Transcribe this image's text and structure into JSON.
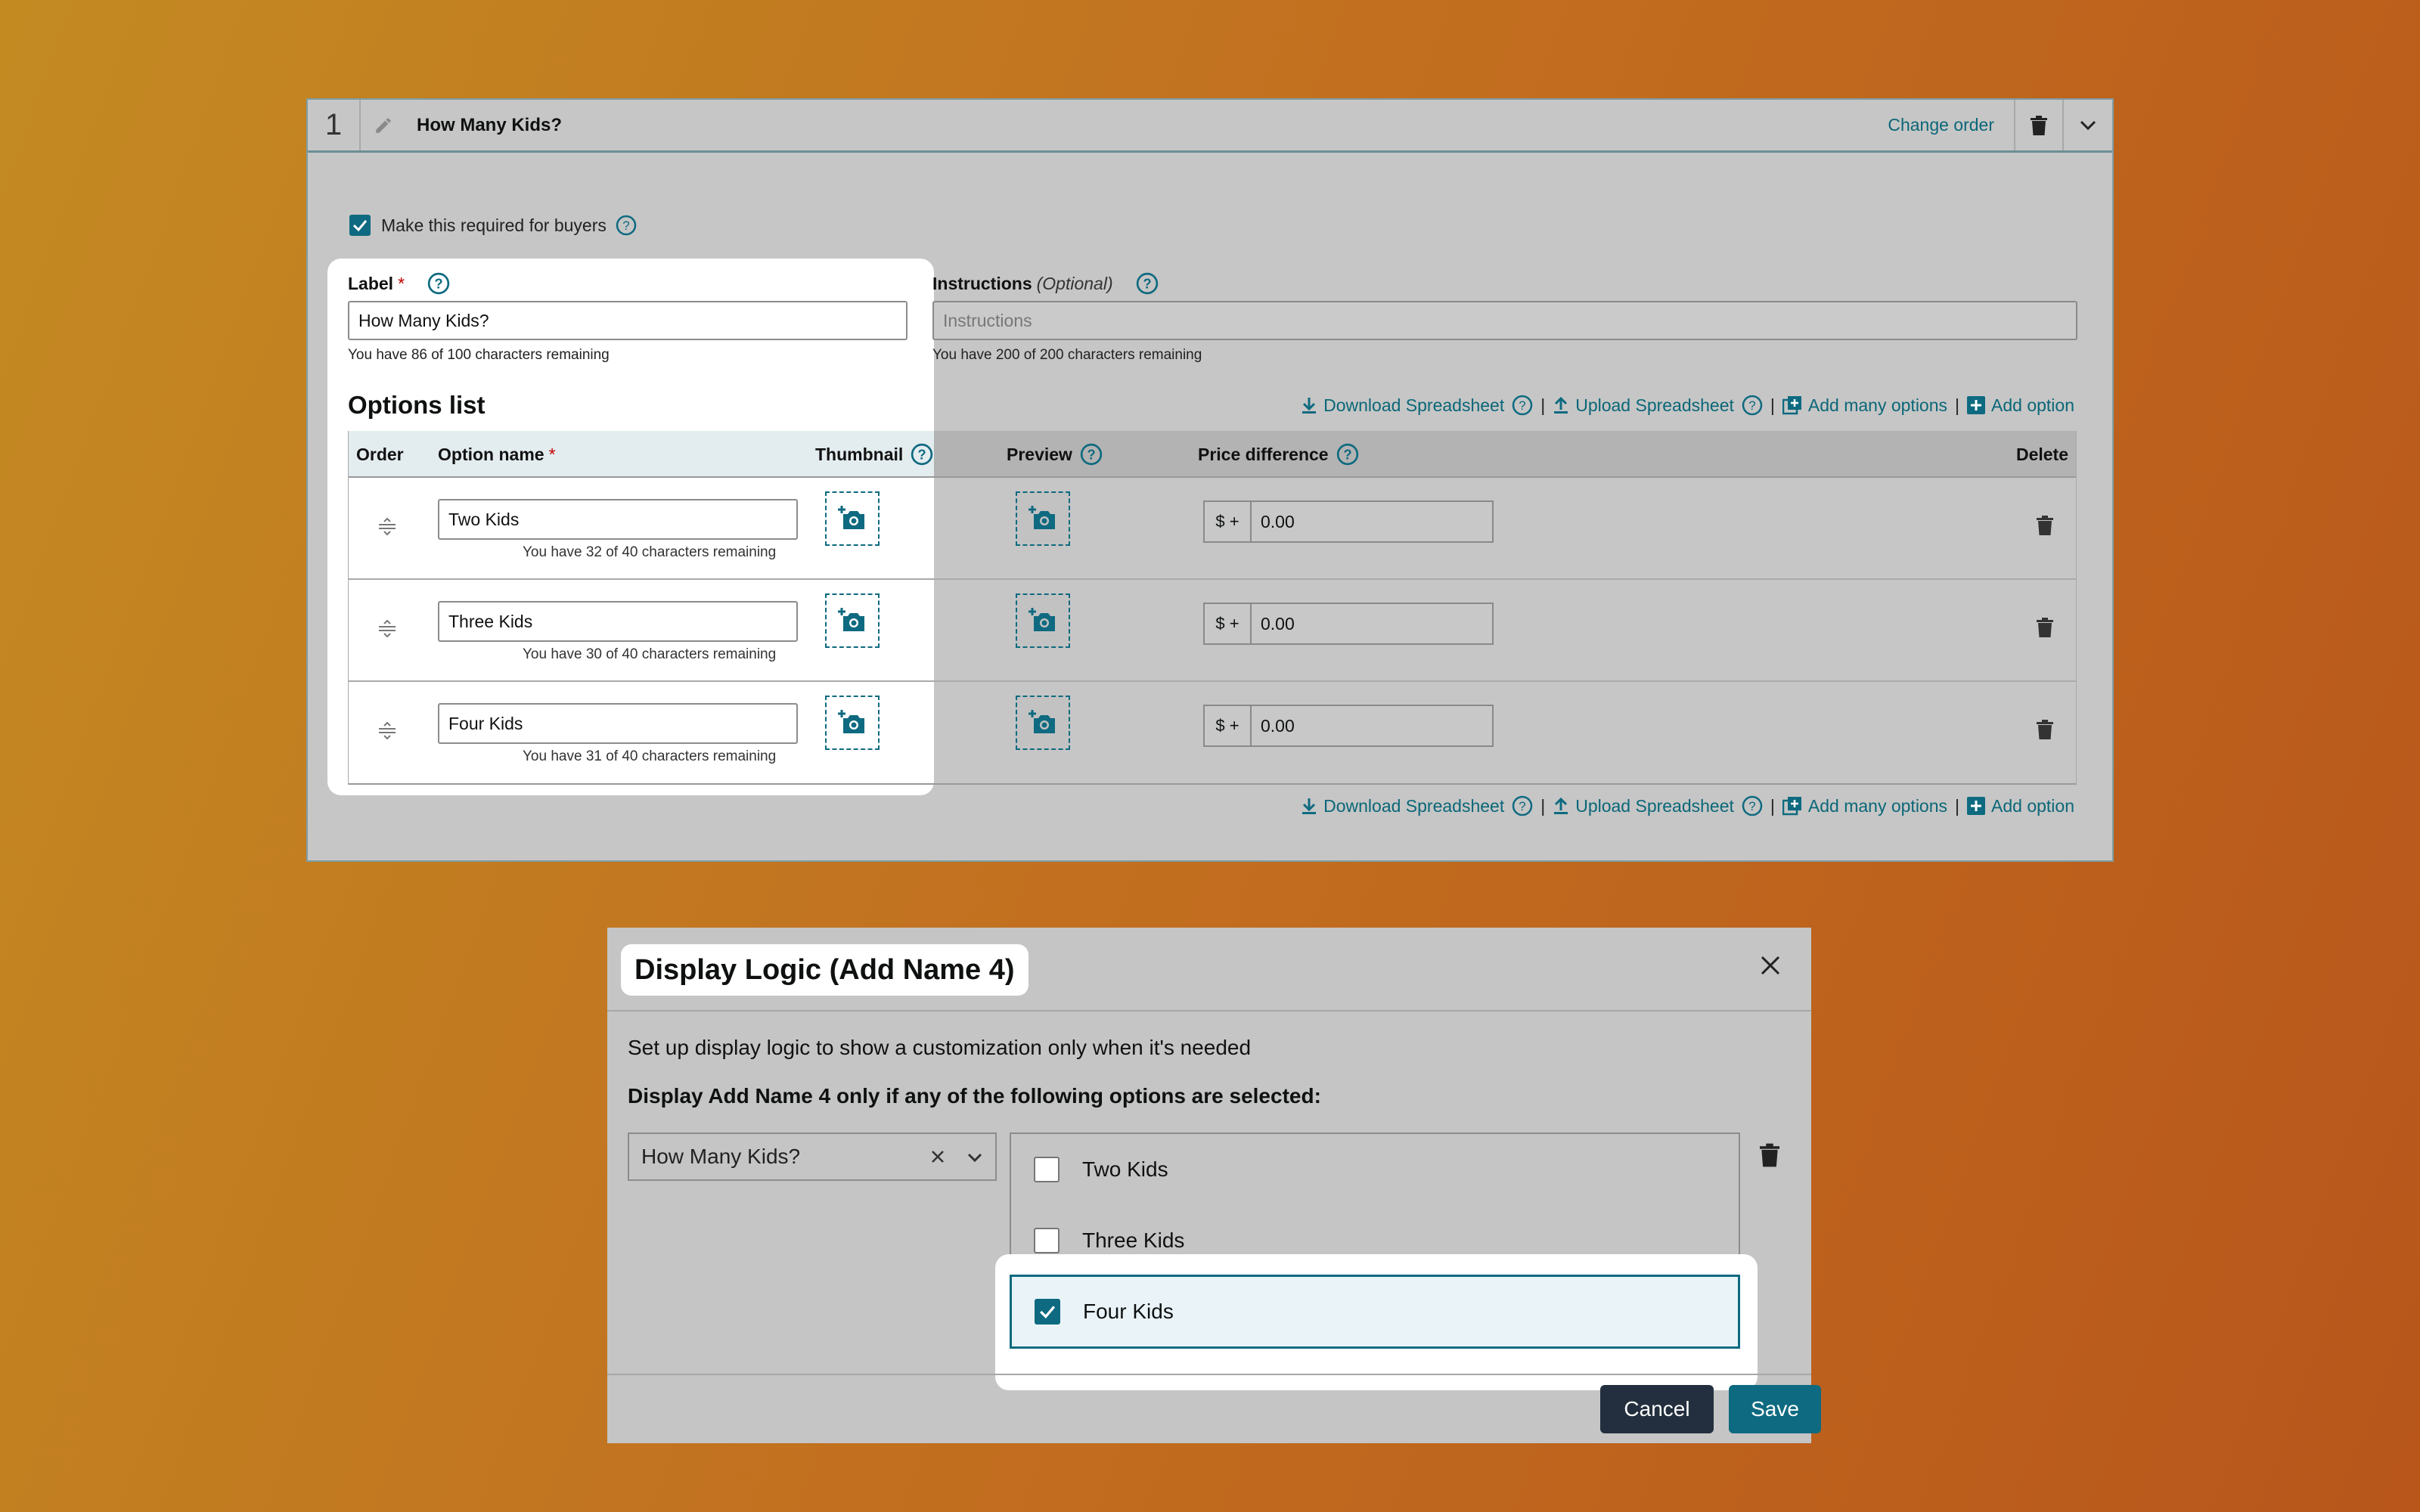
{
  "card": {
    "number": "1",
    "title": "How Many Kids?",
    "change_order": "Change order",
    "required_label": "Make this required for buyers",
    "label_title": "Label",
    "required_star": "*",
    "label_value": "How Many Kids?",
    "label_hint": "You have 86 of 100 characters remaining",
    "instructions_title": "Instructions",
    "instructions_optional": "(Optional)",
    "instructions_placeholder": "Instructions",
    "instructions_hint": "You have 200 of 200 characters remaining",
    "options_title": "Options list",
    "links": {
      "download": "Download Spreadsheet",
      "upload": "Upload Spreadsheet",
      "add_many": "Add many options",
      "add": "Add option",
      "separator": "|"
    },
    "columns": {
      "order": "Order",
      "option_name": "Option name",
      "thumbnail": "Thumbnail",
      "preview": "Preview",
      "price_difference": "Price difference",
      "delete": "Delete"
    },
    "rows": [
      {
        "name": "Two Kids",
        "hint": "You have 32 of 40 characters remaining",
        "prefix": "$ +",
        "price": "0.00"
      },
      {
        "name": "Three Kids",
        "hint": "You have 30 of 40 characters remaining",
        "prefix": "$ +",
        "price": "0.00"
      },
      {
        "name": "Four Kids",
        "hint": "You have 31 of 40 characters remaining",
        "prefix": "$ +",
        "price": "0.00"
      }
    ]
  },
  "dialog": {
    "title": "Display Logic (Add Name 4)",
    "description": "Set up display logic to show a customization only when it's needed",
    "condition": "Display Add Name 4 only if any of the following options are selected:",
    "select_value": "How Many Kids?",
    "options": [
      {
        "label": "Two Kids",
        "checked": false
      },
      {
        "label": "Three Kids",
        "checked": false
      },
      {
        "label": "Four Kids",
        "checked": true
      }
    ],
    "cancel": "Cancel",
    "save": "Save"
  },
  "colors": {
    "accent": "#0e6a80",
    "dark_button": "#232f3e",
    "background_start": "#c38a22",
    "background_end": "#b8561b"
  },
  "icons": [
    "pencil-icon",
    "trash-icon",
    "chevron-down-icon",
    "help-icon",
    "download-icon",
    "upload-icon",
    "add-many-icon",
    "add-icon",
    "drag-handle-icon",
    "add-photo-icon",
    "close-icon",
    "checkmark-icon"
  ]
}
